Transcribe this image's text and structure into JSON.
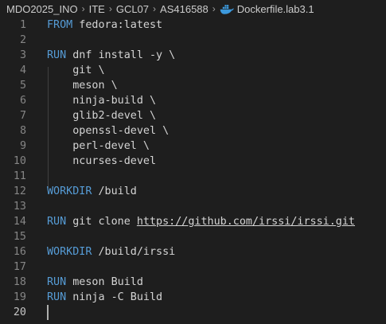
{
  "breadcrumb": {
    "parts": [
      "MDO2025_INO",
      "ITE",
      "GCL07",
      "AS416588"
    ],
    "file": "Dockerfile.lab3.1",
    "file_icon": "docker-whale-icon",
    "separator": "›"
  },
  "editor": {
    "language": "dockerfile",
    "active_line": 20,
    "lines": [
      {
        "number": "1",
        "keyword": "FROM",
        "text": " fedora:latest"
      },
      {
        "number": "2",
        "keyword": "",
        "text": ""
      },
      {
        "number": "3",
        "keyword": "RUN",
        "text": " dnf install -y \\"
      },
      {
        "number": "4",
        "keyword": "",
        "text": "    git \\"
      },
      {
        "number": "5",
        "keyword": "",
        "text": "    meson \\"
      },
      {
        "number": "6",
        "keyword": "",
        "text": "    ninja-build \\"
      },
      {
        "number": "7",
        "keyword": "",
        "text": "    glib2-devel \\"
      },
      {
        "number": "8",
        "keyword": "",
        "text": "    openssl-devel \\"
      },
      {
        "number": "9",
        "keyword": "",
        "text": "    perl-devel \\"
      },
      {
        "number": "10",
        "keyword": "",
        "text": "    ncurses-devel"
      },
      {
        "number": "11",
        "keyword": "",
        "text": ""
      },
      {
        "number": "12",
        "keyword": "WORKDIR",
        "text": " /build"
      },
      {
        "number": "13",
        "keyword": "",
        "text": ""
      },
      {
        "number": "14",
        "keyword": "RUN",
        "text": " git clone ",
        "link": "https://github.com/irssi/irssi.git"
      },
      {
        "number": "15",
        "keyword": "",
        "text": ""
      },
      {
        "number": "16",
        "keyword": "WORKDIR",
        "text": " /build/irssi"
      },
      {
        "number": "17",
        "keyword": "",
        "text": ""
      },
      {
        "number": "18",
        "keyword": "RUN",
        "text": " meson Build"
      },
      {
        "number": "19",
        "keyword": "RUN",
        "text": " ninja -C Build"
      },
      {
        "number": "20",
        "keyword": "",
        "text": ""
      }
    ]
  },
  "colors": {
    "background": "#1e1e1e",
    "keyword": "#569cd6",
    "text": "#d4d4d4",
    "line_number": "#858585",
    "docker_icon": "#3c99dc"
  }
}
